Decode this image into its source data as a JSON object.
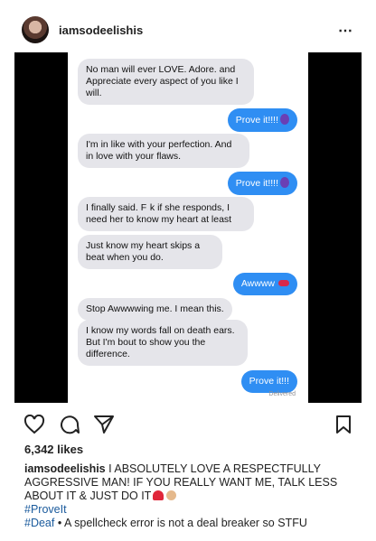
{
  "post": {
    "username": "iamsodeelishis",
    "more_icon": "⋯"
  },
  "messages": [
    {
      "from": "received",
      "text": "No man will ever LOVE. Adore. and Appreciate every aspect of you like I will."
    },
    {
      "from": "sent",
      "text": "Prove it!!!!",
      "emoji": "purple-devil"
    },
    {
      "from": "received",
      "text": "I'm in like with your perfection. And in love with your flaws."
    },
    {
      "from": "sent",
      "text": "Prove it!!!!",
      "emoji": "purple-devil"
    },
    {
      "from": "received",
      "text": "I finally said. F  k if she responds, I need her to know my heart at least"
    },
    {
      "from": "received",
      "text": "Just know my heart skips a beat when you do."
    },
    {
      "from": "sent",
      "text": "Awwww",
      "emoji": "lips"
    },
    {
      "from": "received",
      "text": "Stop Awwwwing me. I mean this."
    },
    {
      "from": "received",
      "text": "I know my words fall on death ears. But I'm bout to show you the difference."
    },
    {
      "from": "sent",
      "text": "Prove it!!!"
    }
  ],
  "delivered_label": "Delivered",
  "likes": "6,342 likes",
  "caption": {
    "username": "iamsodeelishis",
    "text": "I ABSOLUTELY LOVE A RESPECTFULLY AGGRESSIVE MAN! IF YOU REALLY WANT ME, TALK LESS ABOUT IT & JUST DO IT",
    "hashtag1": "#ProveIt",
    "hashtag2": "#Deaf",
    "tail": " • A spellcheck error is not a deal breaker so STFU"
  },
  "icons": [
    "heart-icon",
    "comment-icon",
    "share-icon",
    "bookmark-icon",
    "more-icon"
  ]
}
